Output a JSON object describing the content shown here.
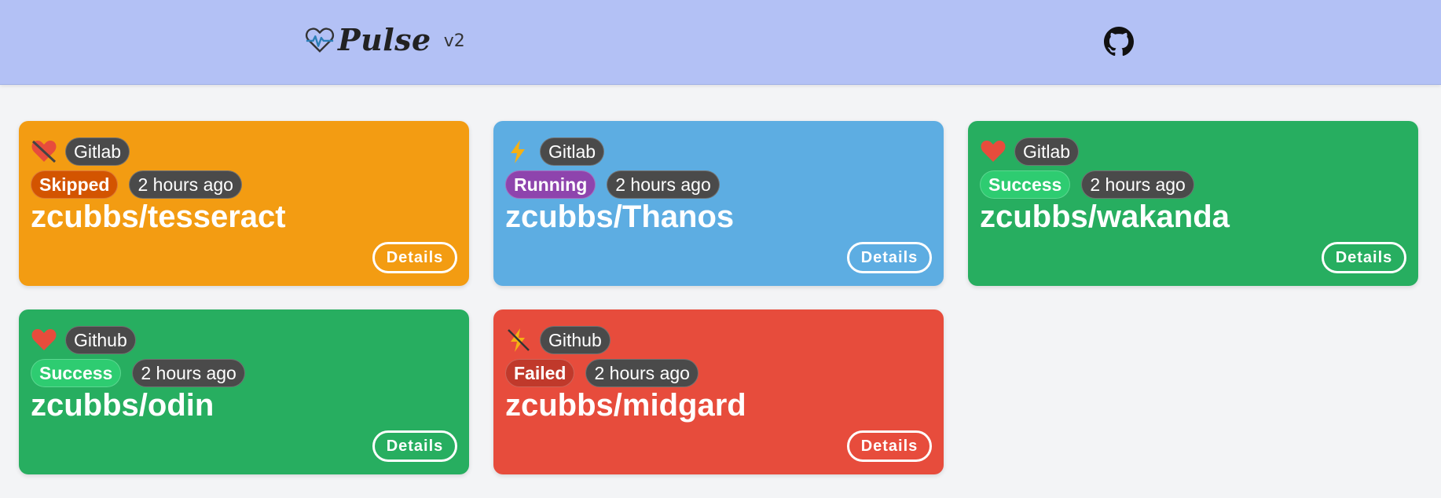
{
  "header": {
    "brand_name": "Pulse",
    "version": "v2"
  },
  "colors": {
    "navbar": "#b3c1f5",
    "skipped_card": "#f39c12",
    "running_card": "#5dade2",
    "success_card": "#27ae60",
    "failed_card": "#e74c3c",
    "skipped_badge": "#d35400",
    "running_badge": "#8e44ad",
    "success_badge": "#2ecc71",
    "failed_badge": "#c0392b",
    "tag_dark": "#4a4a4a"
  },
  "cards": [
    {
      "icon": "broken-heart-icon",
      "provider": "Gitlab",
      "status": "Skipped",
      "time": "2 hours ago",
      "repo": "zcubbs/tesseract",
      "details_label": "Details"
    },
    {
      "icon": "lightning-icon",
      "provider": "Gitlab",
      "status": "Running",
      "time": "2 hours ago",
      "repo": "zcubbs/Thanos",
      "details_label": "Details"
    },
    {
      "icon": "heart-icon",
      "provider": "Gitlab",
      "status": "Success",
      "time": "2 hours ago",
      "repo": "zcubbs/wakanda",
      "details_label": "Details"
    },
    {
      "icon": "heart-icon",
      "provider": "Github",
      "status": "Success",
      "time": "2 hours ago",
      "repo": "zcubbs/odin",
      "details_label": "Details"
    },
    {
      "icon": "crossed-lightning-icon",
      "provider": "Github",
      "status": "Failed",
      "time": "2 hours ago",
      "repo": "zcubbs/midgard",
      "details_label": "Details"
    }
  ]
}
